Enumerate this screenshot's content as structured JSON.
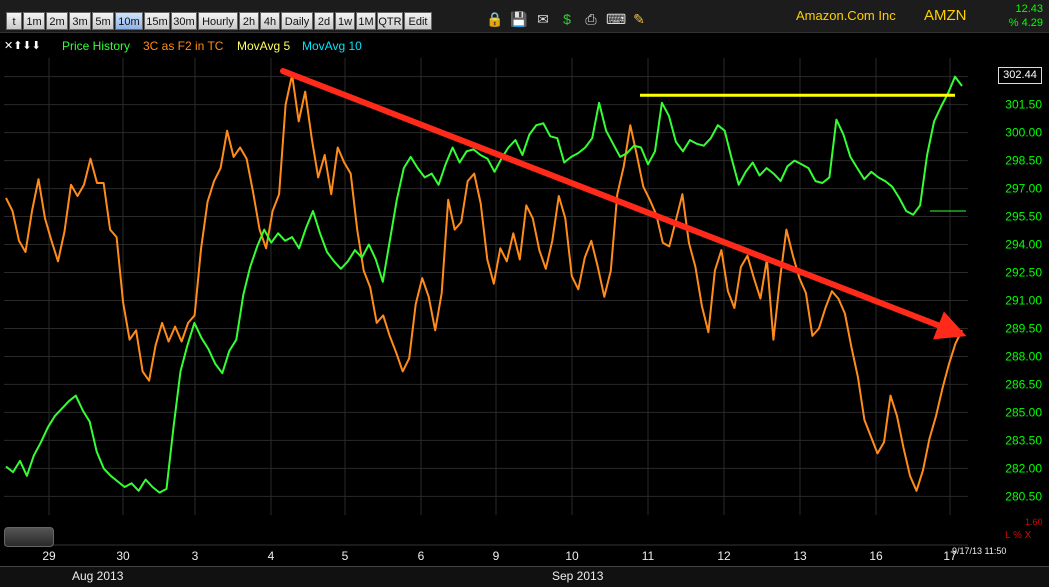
{
  "toolbar": {
    "buttons": [
      "t",
      "1m",
      "2m",
      "3m",
      "5m",
      "10m",
      "15m",
      "30m",
      "Hourly",
      "2h",
      "4h",
      "Daily",
      "2d",
      "1w",
      "1M",
      "QTR",
      "Edit"
    ],
    "active": "10m",
    "icons": [
      "lock-icon",
      "save-icon",
      "mail-icon",
      "dollar-icon",
      "print-icon",
      "keyboard-icon",
      "pencil-icon"
    ]
  },
  "header": {
    "company": "Amazon.Com Inc",
    "ticker": "AMZN",
    "change": "12.43",
    "pct_change": "% 4.29"
  },
  "legend": {
    "price_history": "Price History",
    "indicator": "3C as F2 in TC",
    "mavg5": "MovAvg 5",
    "mavg10": "MovAvg 10"
  },
  "colors": {
    "price": "#33ff33",
    "indicator": "#ff8c1a",
    "resistance": "#ffff00",
    "arrow": "#ff2a1a",
    "axis_text": "#00ff00",
    "mavg10": "#00e5ff",
    "mavg5": "#ffff66"
  },
  "last_price": "302.44",
  "footer": {
    "datetime": "9/17/13 11:50",
    "ls_label": "L % X",
    "ls_value": "1.60",
    "months": [
      "Aug 2013",
      "Sep 2013"
    ]
  },
  "chart_data": {
    "type": "line",
    "title": "",
    "x": [
      "29",
      "30",
      "3",
      "4",
      "5",
      "6",
      "9",
      "10",
      "11",
      "12",
      "13",
      "16",
      "17"
    ],
    "y_ticks": [
      "303.00",
      "301.50",
      "300.00",
      "298.50",
      "297.00",
      "295.50",
      "294.00",
      "292.50",
      "291.00",
      "289.50",
      "288.00",
      "286.50",
      "285.00",
      "283.50",
      "282.00",
      "280.50"
    ],
    "ylim": [
      279.5,
      304.0
    ],
    "grid": true,
    "series": [
      {
        "name": "Price History",
        "values": [
          282.1,
          281.8,
          282.4,
          281.6,
          282.7,
          283.4,
          284.2,
          284.8,
          285.2,
          285.6,
          285.9,
          285.1,
          284.5,
          282.9,
          282.0,
          281.6,
          281.3,
          281.0,
          281.2,
          280.8,
          281.4,
          281.0,
          280.7,
          280.9,
          284.2,
          287.2,
          288.6,
          289.8,
          289.0,
          288.4,
          287.6,
          287.1,
          288.3,
          288.9,
          291.3,
          292.8,
          293.9,
          294.8,
          294.1,
          294.6,
          294.2,
          294.4,
          293.8,
          294.9,
          295.8,
          294.6,
          293.6,
          293.1,
          292.7,
          293.1,
          293.7,
          293.3,
          294.0,
          293.2,
          292.0,
          294.2,
          296.4,
          298.1,
          298.7,
          298.1,
          297.6,
          297.8,
          297.2,
          298.3,
          299.2,
          298.4,
          299.0,
          299.1,
          298.8,
          298.6,
          297.9,
          298.6,
          299.2,
          299.6,
          298.8,
          299.9,
          300.4,
          300.5,
          299.8,
          299.7,
          298.4,
          298.7,
          298.9,
          299.2,
          299.7,
          301.6,
          300.1,
          299.4,
          298.7,
          298.9,
          299.3,
          299.2,
          298.3,
          299.0,
          301.6,
          300.9,
          299.5,
          299.0,
          299.6,
          299.4,
          299.3,
          299.7,
          300.4,
          300.1,
          298.6,
          297.2,
          297.9,
          298.4,
          297.7,
          298.1,
          297.8,
          297.4,
          298.2,
          298.5,
          298.3,
          298.1,
          297.4,
          297.3,
          297.6,
          300.7,
          299.9,
          298.7,
          298.1,
          297.5,
          297.9,
          297.6,
          297.4,
          297.1,
          296.5,
          295.8,
          295.6,
          296.1,
          298.8,
          300.6,
          301.4,
          302.1,
          303.0,
          302.5
        ]
      },
      {
        "name": "3C as F2 in TC",
        "values": [
          296.5,
          295.8,
          294.2,
          293.6,
          295.8,
          297.5,
          295.4,
          294.2,
          293.1,
          294.7,
          297.2,
          296.6,
          297.2,
          298.6,
          297.3,
          297.3,
          294.8,
          294.4,
          290.9,
          288.9,
          289.4,
          287.2,
          286.7,
          288.6,
          289.8,
          288.8,
          289.6,
          288.8,
          289.8,
          290.2,
          293.8,
          296.3,
          297.4,
          298.1,
          300.1,
          298.7,
          299.2,
          298.6,
          296.8,
          294.8,
          293.8,
          295.8,
          296.7,
          301.5,
          303.1,
          300.6,
          302.2,
          299.7,
          297.6,
          298.8,
          296.7,
          299.2,
          298.4,
          297.8,
          294.8,
          292.6,
          291.7,
          289.8,
          290.2,
          289.1,
          288.2,
          287.2,
          287.9,
          290.8,
          292.2,
          291.2,
          289.4,
          291.4,
          296.4,
          294.8,
          295.2,
          297.4,
          297.8,
          296.2,
          293.2,
          291.9,
          293.8,
          293.1,
          294.6,
          293.2,
          296.1,
          295.4,
          293.7,
          292.7,
          294.2,
          296.6,
          295.4,
          292.3,
          291.6,
          293.3,
          294.2,
          292.8,
          291.2,
          292.6,
          296.7,
          298.2,
          300.4,
          298.8,
          297.1,
          296.4,
          295.6,
          294.1,
          293.9,
          295.3,
          296.7,
          294.1,
          292.8,
          290.7,
          289.3,
          292.6,
          293.7,
          291.5,
          290.6,
          292.8,
          293.4,
          292.2,
          291.1,
          293.2,
          288.9,
          292.1,
          294.8,
          293.4,
          292.2,
          291.4,
          289.1,
          289.5,
          290.6,
          291.5,
          291.1,
          290.3,
          288.5,
          286.9,
          284.6,
          283.7,
          282.8,
          283.4,
          285.9,
          284.8,
          283.1,
          281.6,
          280.8,
          281.9,
          283.6,
          284.8,
          286.3,
          287.6,
          288.7,
          289.4
        ]
      }
    ],
    "resistance_level": 302.0,
    "trend_arrow": {
      "from": [
        "4",
        303.3
      ],
      "to": [
        "17",
        289.1
      ]
    }
  }
}
